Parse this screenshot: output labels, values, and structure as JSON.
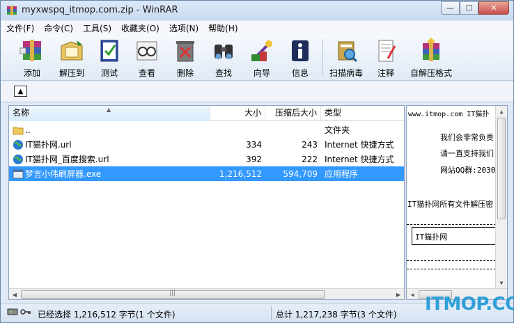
{
  "window": {
    "title": "myxwspq_itmop.com.zip - WinRAR",
    "controls": {
      "minimize": "—",
      "maximize": "☐",
      "close": "✕"
    }
  },
  "menu": [
    "文件(F)",
    "命令(C)",
    "工具(S)",
    "收藏夹(O)",
    "选项(N)",
    "帮助(H)"
  ],
  "toolbar": [
    {
      "label": "添加",
      "icon": "add-archive-icon"
    },
    {
      "label": "解压到",
      "icon": "extract-to-icon"
    },
    {
      "label": "测试",
      "icon": "test-archive-icon"
    },
    {
      "label": "查看",
      "icon": "view-icon"
    },
    {
      "label": "删除",
      "icon": "delete-icon"
    },
    {
      "label": "查找",
      "icon": "find-icon"
    },
    {
      "label": "向导",
      "icon": "wizard-icon"
    },
    {
      "label": "信息",
      "icon": "info-icon"
    },
    {
      "label": "扫描病毒",
      "icon": "virus-scan-icon"
    },
    {
      "label": "注释",
      "icon": "comment-icon"
    },
    {
      "label": "自解压格式",
      "icon": "sfx-icon"
    }
  ],
  "address": {
    "up_icon": "up-folder-icon",
    "up_glyph": "▲"
  },
  "columns": {
    "name": "名称",
    "size": "大小",
    "packed": "压缩后大小",
    "type": "类型",
    "sort_glyph": "▲"
  },
  "files": [
    {
      "name": "..",
      "size": "",
      "packed": "",
      "type": "文件夹",
      "icon": "folder-icon"
    },
    {
      "name": "IT猫扑网.url",
      "size": "334",
      "packed": "243",
      "type": "Internet 快捷方式",
      "icon": "internet-shortcut-icon"
    },
    {
      "name": "IT猫扑网_百度搜索.url",
      "size": "392",
      "packed": "222",
      "type": "Internet 快捷方式",
      "icon": "internet-shortcut-icon"
    },
    {
      "name": "梦言小伟刷屏器.exe",
      "size": "1,216,512",
      "packed": "594,709",
      "type": "应用程序",
      "icon": "exe-icon",
      "selected": true
    }
  ],
  "comment": {
    "line1": "www.itmop.com   IT猫扑",
    "line2": "我们会非常负责",
    "line3": "请一直支持我们",
    "line4": "网站QQ群:2030",
    "line5": "IT猫扑网所有文件解压密",
    "box": "IT猫扑网"
  },
  "status": {
    "left": "已经选择 1,216,512 字节(1 个文件)",
    "right": "总计 1,217,238 字节(3 个文件)"
  },
  "watermark": "ITMOP.COM",
  "colors": {
    "selection": "#3399ff",
    "watermark": "#2e9fd8"
  }
}
